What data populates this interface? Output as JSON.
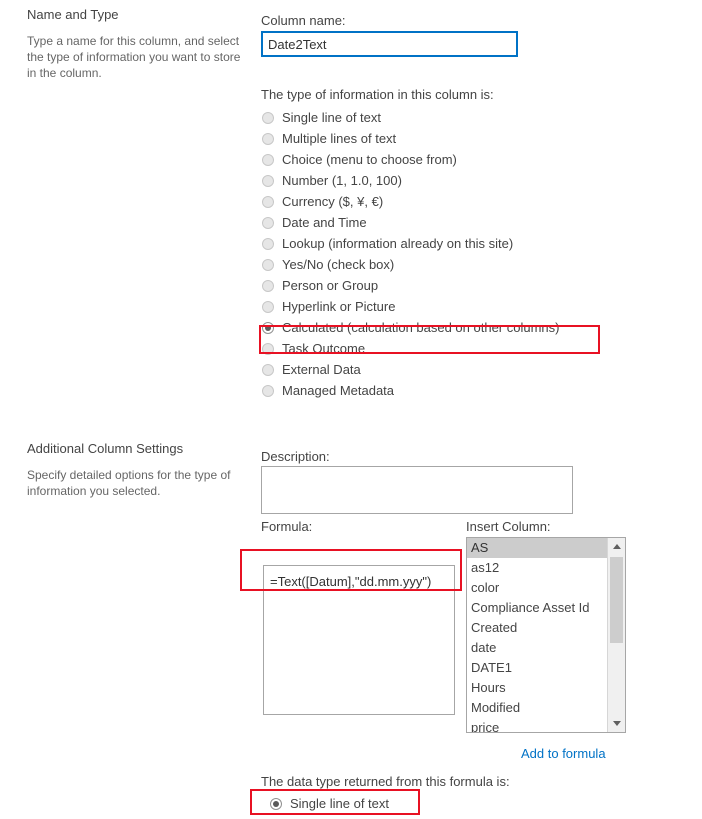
{
  "sections": {
    "name_and_type": {
      "title": "Name and Type",
      "description": "Type a name for this column, and select the type of information you want to store in the column."
    },
    "additional_settings": {
      "title": "Additional Column Settings",
      "description": "Specify detailed options for the type of information you selected."
    }
  },
  "column_name": {
    "label": "Column name:",
    "value": "Date2Text"
  },
  "type_group": {
    "label": "The type of information in this column is:",
    "selected": "Calculated (calculation based on other columns)",
    "options": [
      {
        "label": "Single line of text",
        "checked": false
      },
      {
        "label": "Multiple lines of text",
        "checked": false
      },
      {
        "label": "Choice (menu to choose from)",
        "checked": false
      },
      {
        "label": "Number (1, 1.0, 100)",
        "checked": false
      },
      {
        "label": "Currency ($, ¥, €)",
        "checked": false
      },
      {
        "label": "Date and Time",
        "checked": false
      },
      {
        "label": "Lookup (information already on this site)",
        "checked": false
      },
      {
        "label": "Yes/No (check box)",
        "checked": false
      },
      {
        "label": "Person or Group",
        "checked": false
      },
      {
        "label": "Hyperlink or Picture",
        "checked": false
      },
      {
        "label": "Calculated (calculation based on other columns)",
        "checked": true
      },
      {
        "label": "Task Outcome",
        "checked": false
      },
      {
        "label": "External Data",
        "checked": false
      },
      {
        "label": "Managed Metadata",
        "checked": false
      }
    ]
  },
  "description_field": {
    "label": "Description:",
    "value": "",
    "placeholder": ""
  },
  "formula_field": {
    "label": "Formula:",
    "value": "=Text([Datum],\"dd.mm.yyy\")",
    "placeholder": ""
  },
  "insert_column": {
    "label": "Insert Column:",
    "selected": "AS",
    "items": [
      "AS",
      "as12",
      "color",
      "Compliance Asset Id",
      "Created",
      "date",
      "DATE1",
      "Hours",
      "Modified",
      "price"
    ],
    "add_link": "Add to formula"
  },
  "return_type": {
    "label": "The data type returned from this formula is:",
    "selected": "Single line of text",
    "options": [
      {
        "label": "Single line of text",
        "checked": true
      }
    ]
  },
  "colors": {
    "highlight": "#e81123",
    "link": "#0072c6",
    "focus_border": "#0072c6",
    "list_selected": "#cccccc"
  }
}
